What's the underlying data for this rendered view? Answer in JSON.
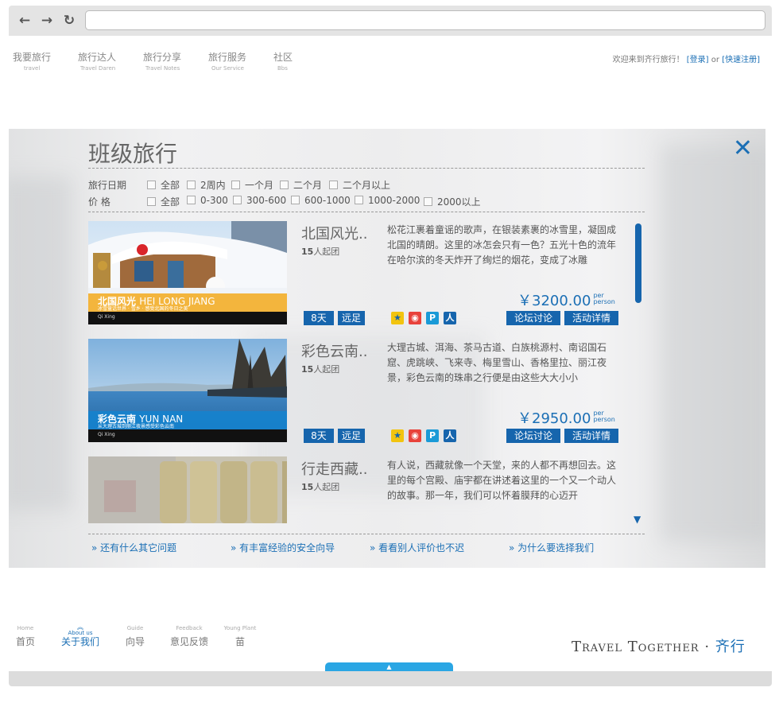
{
  "browser": {
    "back_icon": "←",
    "forward_icon": "→",
    "reload_icon": "↻",
    "url": ""
  },
  "topnav": [
    {
      "zh": "我要旅行",
      "en": "travel"
    },
    {
      "zh": "旅行达人",
      "en": "Travel Daren"
    },
    {
      "zh": "旅行分享",
      "en": "Travel Notes"
    },
    {
      "zh": "旅行服务",
      "en": "Our Service"
    },
    {
      "zh": "社区",
      "en": "Bbs"
    }
  ],
  "welcome": {
    "text": "欢迎来到齐行旅行！",
    "login": "[登录]",
    "or": "or",
    "register": "[快速注册]"
  },
  "panel": {
    "title": "班级旅行",
    "close_icon": "✕",
    "filters": {
      "date_label": "旅行日期",
      "date_options": [
        "全部",
        "2周内",
        "一个月",
        "二个月",
        "二个月以上"
      ],
      "price_label": "价 格",
      "price_options": [
        "全部",
        "0-300",
        "300-600",
        "600-1000",
        "1000-2000",
        "2000以上"
      ]
    },
    "items": [
      {
        "name": "北国风光..",
        "min_num": "15",
        "min_text": "人起团",
        "desc": "松花江裹着童谣的歌声，在银装素裹的冰雪里，凝固成北国的晴朗。这里的冰怎会只有一色？五光十色的流年在哈尔滨的冬天炸开了绚烂的烟花，变成了冰雕",
        "price": "￥3200.00",
        "per1": "per",
        "per2": "person",
        "tag_days": "8天",
        "tag_type": "远足",
        "forum": "论坛讨论",
        "detail": "活动详情",
        "caption_cn": "北国风光",
        "caption_en": "HEI LONG JIANG",
        "caption_sub": "冰雪童话世界 · 雪乡 · 感受北国的冬日之美",
        "caption_foot": "Qi Xing"
      },
      {
        "name": "彩色云南..",
        "min_num": "15",
        "min_text": "人起团",
        "desc": "大理古城、洱海、茶马古道、白族桃源村、南诏国石窟、虎跳峡、飞来寺、梅里雪山、香格里拉、丽江夜景，彩色云南的珠串之行便是由这些大大小小",
        "price": "￥2950.00",
        "per1": "per",
        "per2": "person",
        "tag_days": "8天",
        "tag_type": "远足",
        "forum": "论坛讨论",
        "detail": "活动详情",
        "caption_cn": "彩色云南",
        "caption_en": "YUN NAN",
        "caption_sub": "从大理古城到丽江夜景感受彩色云南",
        "caption_foot": "Qi Xing"
      },
      {
        "name": "行走西藏..",
        "min_num": "15",
        "min_text": "人起团",
        "desc": "有人说，西藏就像一个天堂，来的人都不再想回去。这里的每个宫殿、庙宇都在讲述着这里的一个又一个动人的故事。那一年，我们可以怀着膜拜的心迈开"
      }
    ],
    "share_icons": [
      "qzone-icon",
      "weibo-icon",
      "qq-icon",
      "renren-icon"
    ],
    "scroll_down_icon": "▼",
    "faq": [
      "还有什么其它问题",
      "有丰富经验的安全向导",
      "看看别人评价也不迟",
      "为什么要选择我们"
    ],
    "faq_icon": "»"
  },
  "footer": {
    "nav": [
      {
        "en": "Home",
        "zh": "首页"
      },
      {
        "en": "About us",
        "zh": "关于我们"
      },
      {
        "en": "Guide",
        "zh": "向导"
      },
      {
        "en": "Feedback",
        "zh": "意见反馈"
      },
      {
        "en": "Young Plant",
        "zh": "苗"
      }
    ],
    "brand_en": "Travel Together",
    "brand_dot": "·",
    "brand_cn": "齐行",
    "handle_icon": "▲"
  },
  "colors": {
    "accent": "#1b6fb5",
    "tag": "#1665ad",
    "handle": "#2aa6e4"
  }
}
